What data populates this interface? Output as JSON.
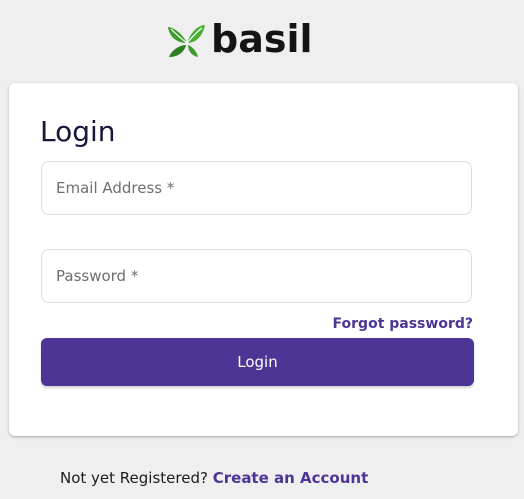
{
  "brand": {
    "name": "basil",
    "icon": "leaf-icon",
    "leaf_color": "#3f9b2d",
    "text_color": "#141414"
  },
  "login_card": {
    "title": "Login",
    "email_placeholder": "Email Address *",
    "email_value": "",
    "password_placeholder": "Password *",
    "password_value": "",
    "forgot_label": "Forgot password?",
    "submit_label": "Login"
  },
  "footer": {
    "prompt": "Not yet Registered?",
    "link_label": "Create an Account"
  },
  "colors": {
    "accent": "#4d3596",
    "background": "#efefef",
    "card": "#ffffff"
  }
}
